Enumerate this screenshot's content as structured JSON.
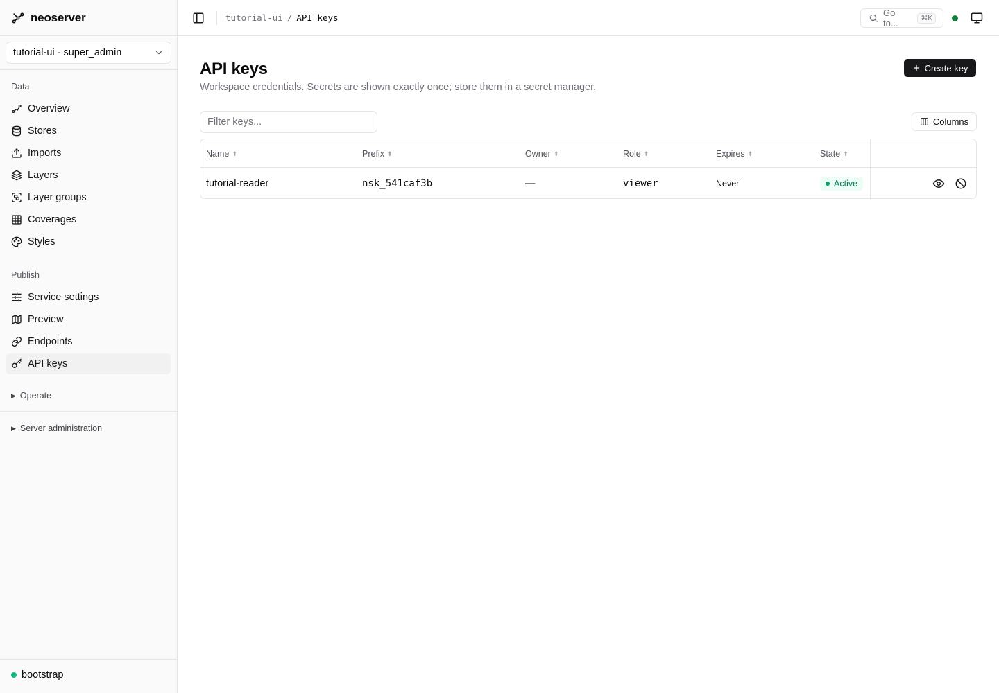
{
  "brand": {
    "name": "neoserver",
    "icon": "workflow-icon"
  },
  "workspace_selector": {
    "label": "tutorial-ui · super_admin"
  },
  "sidebar": {
    "sections": [
      {
        "title": "Data",
        "items": [
          {
            "label": "Overview",
            "icon": "activity-icon"
          },
          {
            "label": "Stores",
            "icon": "database-icon"
          },
          {
            "label": "Imports",
            "icon": "upload-icon"
          },
          {
            "label": "Layers",
            "icon": "layers-icon"
          },
          {
            "label": "Layer groups",
            "icon": "group-icon"
          },
          {
            "label": "Coverages",
            "icon": "grid-icon"
          },
          {
            "label": "Styles",
            "icon": "palette-icon"
          }
        ]
      },
      {
        "title": "Publish",
        "items": [
          {
            "label": "Service settings",
            "icon": "sliders-icon"
          },
          {
            "label": "Preview",
            "icon": "map-icon"
          },
          {
            "label": "Endpoints",
            "icon": "link-icon"
          },
          {
            "label": "API keys",
            "icon": "key-icon",
            "active": true
          }
        ]
      }
    ],
    "collapsed": [
      "Operate",
      "Server administration"
    ],
    "user": {
      "name": "bootstrap",
      "status_color": "#10b981"
    }
  },
  "topbar": {
    "breadcrumb": [
      "tutorial-ui",
      "API keys"
    ],
    "breadcrumb_sep": "/",
    "goto": {
      "label": "Go to...",
      "shortcut": "⌘K"
    },
    "status_color": "#15803d"
  },
  "page": {
    "title": "API keys",
    "description": "Workspace credentials. Secrets are shown exactly once; store them in a secret manager.",
    "create_label": "Create key",
    "filter_placeholder": "Filter keys...",
    "columns_label": "Columns"
  },
  "table": {
    "columns": [
      "Name",
      "Prefix",
      "Owner",
      "Role",
      "Expires",
      "State"
    ],
    "rows": [
      {
        "name": "tutorial-reader",
        "prefix": "nsk_541caf3b",
        "owner": "—",
        "role": "viewer",
        "expires": "Never",
        "state": "Active"
      }
    ]
  },
  "colors": {
    "primary_button": "#18181b",
    "active_badge_bg": "#ecfdf5",
    "active_badge_text": "#047857"
  }
}
